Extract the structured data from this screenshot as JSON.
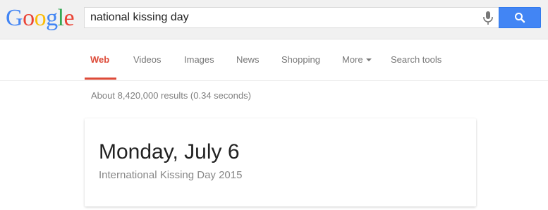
{
  "logo": {
    "letters": [
      "G",
      "o",
      "o",
      "g",
      "l",
      "e"
    ]
  },
  "search": {
    "query": "national kissing day"
  },
  "tabs": [
    {
      "label": "Web"
    },
    {
      "label": "Videos"
    },
    {
      "label": "Images"
    },
    {
      "label": "News"
    },
    {
      "label": "Shopping"
    },
    {
      "label": "More"
    },
    {
      "label": "Search tools"
    }
  ],
  "results": {
    "stats": "About 8,420,000 results (0.34 seconds)"
  },
  "answer_card": {
    "title": "Monday, July 6",
    "subtitle": "International Kissing Day 2015"
  },
  "colors": {
    "accent": "#dd4b39",
    "search_button": "#4285f4",
    "header_bg": "#f1f1f1"
  },
  "icons": {
    "mic": "microphone-icon",
    "search": "search-icon",
    "more_caret": "caret-down-icon"
  }
}
